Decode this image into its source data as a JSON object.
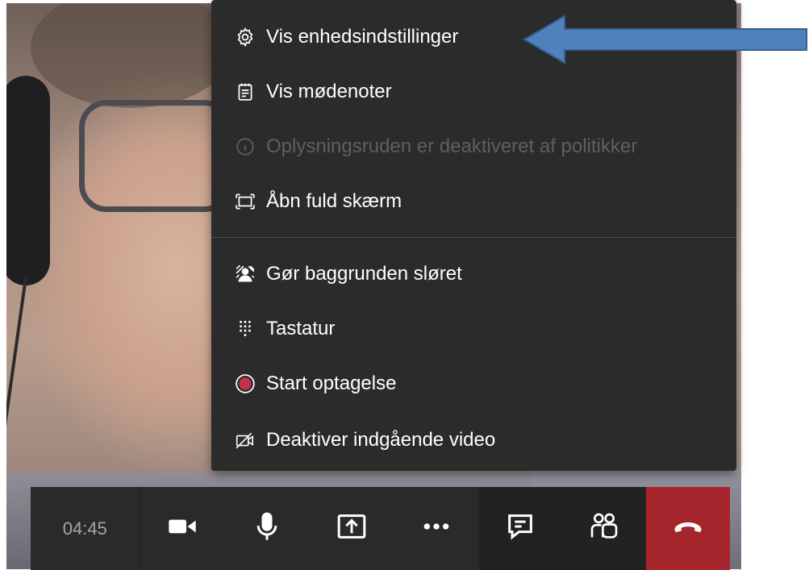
{
  "menu": {
    "items": [
      {
        "label": "Vis enhedsindstillinger",
        "icon": "gear-icon",
        "enabled": true
      },
      {
        "label": "Vis mødenoter",
        "icon": "notes-icon",
        "enabled": true
      },
      {
        "label": "Oplysningsruden er deaktiveret af politikker",
        "icon": "info-icon",
        "enabled": false
      },
      {
        "label": "Åbn fuld skærm",
        "icon": "fullscreen-icon",
        "enabled": true
      },
      {
        "label": "Gør baggrunden sløret",
        "icon": "blur-background-icon",
        "enabled": true
      },
      {
        "label": "Tastatur",
        "icon": "dialpad-icon",
        "enabled": true
      },
      {
        "label": "Start optagelse",
        "icon": "record-icon",
        "enabled": true
      },
      {
        "label": "Deaktiver indgående video",
        "icon": "video-off-icon",
        "enabled": true
      }
    ]
  },
  "callbar": {
    "timer": "04:45",
    "buttons": [
      "camera-icon",
      "microphone-icon",
      "share-screen-icon",
      "more-options-icon",
      "chat-icon",
      "participants-icon",
      "hang-up-icon"
    ]
  },
  "colors": {
    "menu_bg": "#2b2b2b",
    "disabled_text": "#5f5f5f",
    "record_red": "#c4314b",
    "hangup_red": "#a4262c",
    "annotation_arrow": "#4f81bd"
  }
}
